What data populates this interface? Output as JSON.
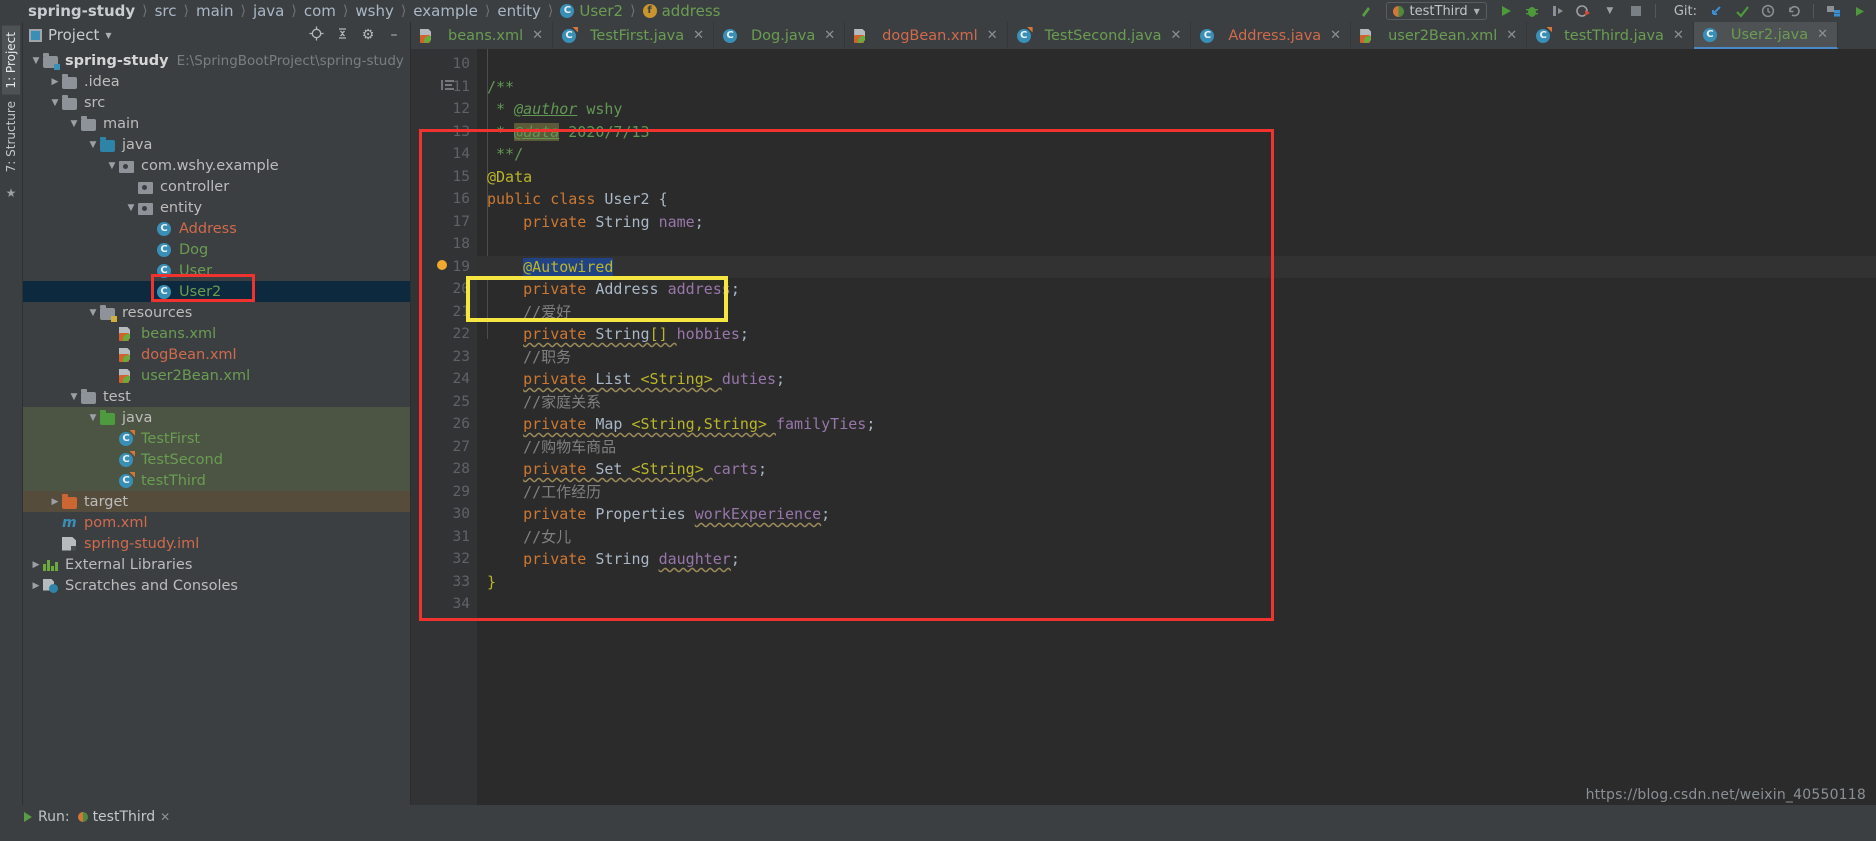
{
  "breadcrumb": {
    "root": "spring-study",
    "items": [
      "src",
      "main",
      "java",
      "com",
      "wshy",
      "example",
      "entity"
    ],
    "class": "User2",
    "field": "address"
  },
  "toolbar": {
    "run_config": "testThird",
    "git_label": "Git:",
    "icons": [
      "build-icon",
      "run-icon",
      "debug-icon",
      "run-coverage-icon",
      "profiler-icon",
      "stop-icon",
      "update-project-icon",
      "commit-icon",
      "history-icon",
      "rollback-icon",
      "settings-sync-icon",
      "play-icon"
    ]
  },
  "left_strip": {
    "project_tab": "1: Project",
    "structure_tab": "7: Structure",
    "favorites_tab": "2: Favorites"
  },
  "project_panel": {
    "title": "Project",
    "header_icons": [
      "locate-icon",
      "collapse-all-icon",
      "gear-icon",
      "minimize-icon"
    ],
    "tree": [
      {
        "label": "spring-study",
        "path": "E:\\SpringBootProject\\spring-study",
        "indent": 0,
        "arrow": "down",
        "icon": "module-folder-icon",
        "style": "bold"
      },
      {
        "label": ".idea",
        "indent": 1,
        "arrow": "right",
        "icon": "folder-icon"
      },
      {
        "label": "src",
        "indent": 1,
        "arrow": "down",
        "icon": "folder-icon"
      },
      {
        "label": "main",
        "indent": 2,
        "arrow": "down",
        "icon": "folder-icon"
      },
      {
        "label": "java",
        "indent": 3,
        "arrow": "down",
        "icon": "source-folder-icon"
      },
      {
        "label": "com.wshy.example",
        "indent": 4,
        "arrow": "down",
        "icon": "package-icon"
      },
      {
        "label": "controller",
        "indent": 5,
        "arrow": "none",
        "icon": "package-icon"
      },
      {
        "label": "entity",
        "indent": 5,
        "arrow": "down",
        "icon": "package-icon"
      },
      {
        "label": "Address",
        "indent": 6,
        "arrow": "none",
        "icon": "class-icon",
        "style": "red"
      },
      {
        "label": "Dog",
        "indent": 6,
        "arrow": "none",
        "icon": "class-icon",
        "style": "green"
      },
      {
        "label": "User",
        "indent": 6,
        "arrow": "none",
        "icon": "class-icon",
        "style": "green"
      },
      {
        "label": "User2",
        "indent": 6,
        "arrow": "none",
        "icon": "class-icon",
        "style": "green",
        "selected": true,
        "annotated": true
      },
      {
        "label": "resources",
        "indent": 3,
        "arrow": "down",
        "icon": "resource-folder-icon"
      },
      {
        "label": "beans.xml",
        "indent": 4,
        "arrow": "none",
        "icon": "spring-xml-icon",
        "style": "green"
      },
      {
        "label": "dogBean.xml",
        "indent": 4,
        "arrow": "none",
        "icon": "spring-xml-icon",
        "style": "red"
      },
      {
        "label": "user2Bean.xml",
        "indent": 4,
        "arrow": "none",
        "icon": "spring-xml-icon",
        "style": "green"
      },
      {
        "label": "test",
        "indent": 2,
        "arrow": "down",
        "icon": "folder-icon"
      },
      {
        "label": "java",
        "indent": 3,
        "arrow": "down",
        "icon": "test-source-folder-icon",
        "row": "testroot"
      },
      {
        "label": "TestFirst",
        "indent": 4,
        "arrow": "none",
        "icon": "test-class-icon",
        "style": "green",
        "row": "testroot"
      },
      {
        "label": "TestSecond",
        "indent": 4,
        "arrow": "none",
        "icon": "test-class-icon",
        "style": "green",
        "row": "testroot"
      },
      {
        "label": "testThird",
        "indent": 4,
        "arrow": "none",
        "icon": "test-class-icon",
        "style": "green",
        "row": "testroot"
      },
      {
        "label": "target",
        "indent": 1,
        "arrow": "right",
        "icon": "excluded-folder-icon",
        "row": "targetroot"
      },
      {
        "label": "pom.xml",
        "indent": 1,
        "arrow": "none",
        "icon": "maven-icon",
        "style": "red"
      },
      {
        "label": "spring-study.iml",
        "indent": 1,
        "arrow": "none",
        "icon": "iml-icon",
        "style": "red"
      },
      {
        "label": "External Libraries",
        "indent": 0,
        "arrow": "right",
        "icon": "libraries-icon"
      },
      {
        "label": "Scratches and Consoles",
        "indent": 0,
        "arrow": "right",
        "icon": "scratches-icon"
      }
    ]
  },
  "editor_tabs": [
    {
      "label": "beans.xml",
      "icon": "spring-xml-icon",
      "style": "green",
      "active": false
    },
    {
      "label": "TestFirst.java",
      "icon": "test-class-icon",
      "style": "green",
      "active": false
    },
    {
      "label": "Dog.java",
      "icon": "class-icon",
      "style": "green",
      "active": false
    },
    {
      "label": "dogBean.xml",
      "icon": "spring-xml-icon",
      "style": "red",
      "active": false
    },
    {
      "label": "TestSecond.java",
      "icon": "test-class-icon",
      "style": "green",
      "active": false
    },
    {
      "label": "Address.java",
      "icon": "class-icon",
      "style": "red",
      "active": false
    },
    {
      "label": "user2Bean.xml",
      "icon": "spring-xml-icon",
      "style": "green",
      "active": false
    },
    {
      "label": "testThird.java",
      "icon": "test-class-icon",
      "style": "green",
      "active": false
    },
    {
      "label": "User2.java",
      "icon": "class-icon",
      "style": "green",
      "active": true
    }
  ],
  "code": {
    "first_line_number": 10,
    "lines": [
      {
        "n": 10,
        "segments": []
      },
      {
        "n": 11,
        "gutter_mark": "hierarchy",
        "fold": "down",
        "segments": [
          {
            "t": "/**",
            "c": "jdoc"
          }
        ]
      },
      {
        "n": 12,
        "segments": [
          {
            "t": " * ",
            "c": "jdoc"
          },
          {
            "t": "@author",
            "c": "jdtag"
          },
          {
            "t": " wshy",
            "c": "jdoc"
          }
        ]
      },
      {
        "n": 13,
        "segments": [
          {
            "t": " * ",
            "c": "jdoc"
          },
          {
            "t": "@data",
            "c": "jdhi"
          },
          {
            "t": " 2020/7/13",
            "c": "jdoc"
          }
        ]
      },
      {
        "n": 14,
        "fold": "up",
        "segments": [
          {
            "t": " **/",
            "c": "jdoc"
          }
        ]
      },
      {
        "n": 15,
        "segments": [
          {
            "t": "@Data",
            "c": "ann"
          }
        ]
      },
      {
        "n": 16,
        "segments": [
          {
            "t": "public class ",
            "c": "kw"
          },
          {
            "t": "User2 ",
            "c": "type"
          },
          {
            "t": "{",
            "c": "br"
          }
        ]
      },
      {
        "n": 17,
        "segments": [
          {
            "t": "    ",
            "c": ""
          },
          {
            "t": "private ",
            "c": "kw"
          },
          {
            "t": "String ",
            "c": "type"
          },
          {
            "t": "name",
            "c": "fld"
          },
          {
            "t": ";",
            "c": "br"
          }
        ]
      },
      {
        "n": 18,
        "segments": []
      },
      {
        "n": 19,
        "bulb": true,
        "current": true,
        "segments": [
          {
            "t": "    ",
            "c": ""
          },
          {
            "t": "@Autowired",
            "c": "ann sel"
          }
        ]
      },
      {
        "n": 20,
        "segments": [
          {
            "t": "    ",
            "c": ""
          },
          {
            "t": "private ",
            "c": "kw"
          },
          {
            "t": "Address ",
            "c": "type"
          },
          {
            "t": "address",
            "c": "fld"
          },
          {
            "t": ";",
            "c": "br"
          }
        ]
      },
      {
        "n": 21,
        "segments": [
          {
            "t": "    //爱好",
            "c": "cmt"
          }
        ]
      },
      {
        "n": 22,
        "segments": [
          {
            "t": "    ",
            "c": ""
          },
          {
            "t": "private ",
            "c": "kw wavy"
          },
          {
            "t": "String",
            "c": "type wavy"
          },
          {
            "t": "[]",
            "c": "yel wavy"
          },
          {
            "t": " ",
            "c": "wavy"
          },
          {
            "t": "hobbies",
            "c": "fld"
          },
          {
            "t": ";",
            "c": "br"
          }
        ]
      },
      {
        "n": 23,
        "segments": [
          {
            "t": "    //职务",
            "c": "cmt"
          }
        ]
      },
      {
        "n": 24,
        "segments": [
          {
            "t": "    ",
            "c": ""
          },
          {
            "t": "private ",
            "c": "kw wavy"
          },
          {
            "t": "List ",
            "c": "type wavy"
          },
          {
            "t": "<String>",
            "c": "yel wavy"
          },
          {
            "t": " ",
            "c": "wavy"
          },
          {
            "t": "duties",
            "c": "fld"
          },
          {
            "t": ";",
            "c": "br"
          }
        ]
      },
      {
        "n": 25,
        "segments": [
          {
            "t": "    //家庭关系",
            "c": "cmt"
          }
        ]
      },
      {
        "n": 26,
        "segments": [
          {
            "t": "    ",
            "c": ""
          },
          {
            "t": "private ",
            "c": "kw wavy"
          },
          {
            "t": "Map ",
            "c": "type wavy"
          },
          {
            "t": "<String,String>",
            "c": "yel wavy"
          },
          {
            "t": " ",
            "c": "wavy"
          },
          {
            "t": "familyTies",
            "c": "fld"
          },
          {
            "t": ";",
            "c": "br"
          }
        ]
      },
      {
        "n": 27,
        "segments": [
          {
            "t": "    //购物车商品",
            "c": "cmt"
          }
        ]
      },
      {
        "n": 28,
        "segments": [
          {
            "t": "    ",
            "c": ""
          },
          {
            "t": "private ",
            "c": "kw wavy"
          },
          {
            "t": "Set ",
            "c": "type wavy"
          },
          {
            "t": "<String>",
            "c": "yel wavy"
          },
          {
            "t": " ",
            "c": "wavy"
          },
          {
            "t": "carts",
            "c": "fld"
          },
          {
            "t": ";",
            "c": "br"
          }
        ]
      },
      {
        "n": 29,
        "segments": [
          {
            "t": "    //工作经历",
            "c": "cmt"
          }
        ]
      },
      {
        "n": 30,
        "segments": [
          {
            "t": "    ",
            "c": ""
          },
          {
            "t": "private ",
            "c": "kw"
          },
          {
            "t": "Properties ",
            "c": "type"
          },
          {
            "t": "workExperience",
            "c": "fld wavy"
          },
          {
            "t": ";",
            "c": "br"
          }
        ]
      },
      {
        "n": 31,
        "segments": [
          {
            "t": "    //女儿",
            "c": "cmt"
          }
        ]
      },
      {
        "n": 32,
        "segments": [
          {
            "t": "    ",
            "c": ""
          },
          {
            "t": "private ",
            "c": "kw"
          },
          {
            "t": "String ",
            "c": "type"
          },
          {
            "t": "daughter",
            "c": "fld wavy"
          },
          {
            "t": ";",
            "c": "br"
          }
        ]
      },
      {
        "n": 33,
        "segments": [
          {
            "t": "}",
            "c": "yel"
          }
        ]
      },
      {
        "n": 34,
        "segments": []
      }
    ]
  },
  "annotations": {
    "red_box_color": "#f0332e",
    "yellow_box_color": "#f5e642",
    "selection_color": "#214283"
  },
  "status_bar": {
    "run_label": "Run:",
    "run_config": "testThird"
  },
  "watermark": "https://blog.csdn.net/weixin_40550118"
}
